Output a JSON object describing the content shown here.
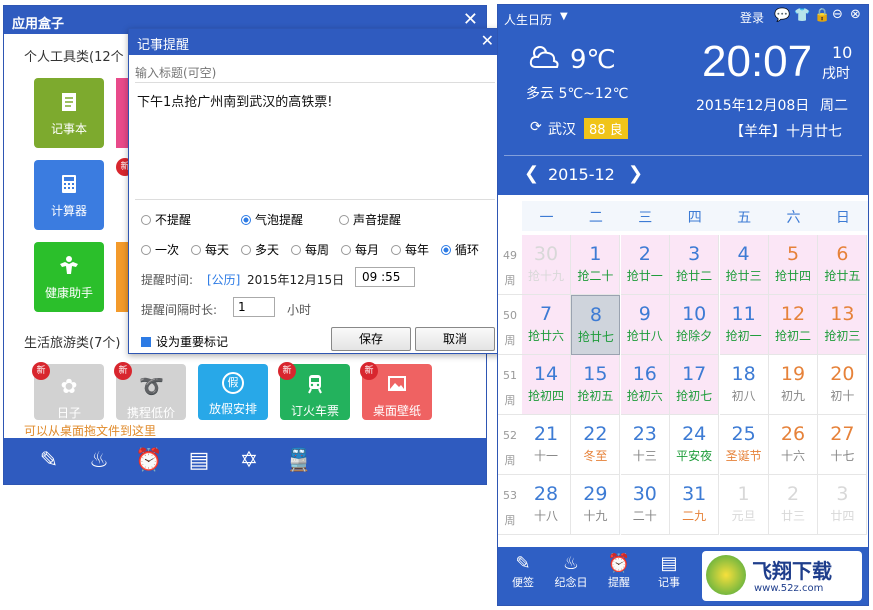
{
  "appbox": {
    "title": "应用盒子",
    "section1": "个人工具类(12个",
    "section2": "生活旅游类(7个)",
    "drag_hint": "可以从桌面拖文件到这里",
    "tiles1": [
      {
        "label": "记事本",
        "color": "#7daa2e",
        "icon": "notepad-icon"
      },
      {
        "label": "计算器",
        "color": "#3b7ce0",
        "icon": "calculator-icon",
        "new": "新"
      },
      {
        "label": "健康助手",
        "color": "#2bbf2b",
        "icon": "fitness-icon"
      }
    ],
    "tiles2": [
      {
        "label": "日子",
        "color": "#cfcfcf",
        "icon": "clover-icon",
        "new": "新"
      },
      {
        "label": "携程低价",
        "color": "#cfcfcf",
        "icon": "dolphin-icon",
        "new": "新"
      },
      {
        "label": "放假安排",
        "color": "#28a8e8",
        "icon": "holiday-icon"
      },
      {
        "label": "订火车票",
        "color": "#23b25d",
        "icon": "train-icon",
        "new": "新"
      },
      {
        "label": "桌面壁纸",
        "color": "#ef6262",
        "icon": "wallpaper-icon",
        "new": "新"
      }
    ]
  },
  "dialog": {
    "title": "记事提醒",
    "title_placeholder": "输入标题(可空)",
    "content": "下午1点抢广州南到武汉的高铁票!",
    "remind_types": [
      "不提醒",
      "气泡提醒",
      "声音提醒"
    ],
    "repeat_types": [
      "一次",
      "每天",
      "多天",
      "每周",
      "每月",
      "每年",
      "循环"
    ],
    "time_label": "提醒时间:",
    "calendar_type": "[公历]",
    "date": "2015年12月15日",
    "time": "09 :55",
    "interval_label": "提醒间隔时长:",
    "interval_value": "1",
    "interval_unit": "小时",
    "important_label": "设为重要标记",
    "save": "保存",
    "cancel": "取消"
  },
  "calendar": {
    "app_title": "人生日历",
    "login": "登录",
    "temp": "9℃",
    "weather": "多云 5℃~12℃",
    "city": "武汉",
    "aqi": "88 良",
    "time": "20:07",
    "seconds": "10",
    "hour_label": "戌时",
    "date": "2015年12月08日",
    "weekday": "周二",
    "lunar": "【羊年】十月廿七",
    "month": "2015-12",
    "weekdays": [
      "一",
      "二",
      "三",
      "四",
      "五",
      "六",
      "日"
    ],
    "weeks": [
      {
        "no": "49",
        "unit": "周",
        "days": [
          {
            "d": "30",
            "l": "抢十九",
            "faded": true
          },
          {
            "d": "1",
            "l": "抢二十"
          },
          {
            "d": "2",
            "l": "抢廿一"
          },
          {
            "d": "3",
            "l": "抢廿二"
          },
          {
            "d": "4",
            "l": "抢廿三"
          },
          {
            "d": "5",
            "l": "抢廿四",
            "weekend": true
          },
          {
            "d": "6",
            "l": "抢廿五",
            "weekend": true
          }
        ]
      },
      {
        "no": "50",
        "unit": "周",
        "days": [
          {
            "d": "7",
            "l": "抢廿六"
          },
          {
            "d": "8",
            "l": "抢廿七",
            "today": true
          },
          {
            "d": "9",
            "l": "抢廿八"
          },
          {
            "d": "10",
            "l": "抢除夕"
          },
          {
            "d": "11",
            "l": "抢初一"
          },
          {
            "d": "12",
            "l": "抢初二",
            "weekend": true
          },
          {
            "d": "13",
            "l": "抢初三",
            "weekend": true
          }
        ]
      },
      {
        "no": "51",
        "unit": "周",
        "days": [
          {
            "d": "14",
            "l": "抢初四"
          },
          {
            "d": "15",
            "l": "抢初五"
          },
          {
            "d": "16",
            "l": "抢初六"
          },
          {
            "d": "17",
            "l": "抢初七"
          },
          {
            "d": "18",
            "l": "初八",
            "plain": true
          },
          {
            "d": "19",
            "l": "初九",
            "plain": true,
            "weekend": true
          },
          {
            "d": "20",
            "l": "初十",
            "plain": true,
            "weekend": true
          }
        ]
      },
      {
        "no": "52",
        "unit": "周",
        "days": [
          {
            "d": "21",
            "l": "十一",
            "plain": true
          },
          {
            "d": "22",
            "l": "冬至",
            "plain": true,
            "fest": true
          },
          {
            "d": "23",
            "l": "十三",
            "plain": true
          },
          {
            "d": "24",
            "l": "平安夜",
            "plain": true,
            "green": true
          },
          {
            "d": "25",
            "l": "圣诞节",
            "plain": true,
            "fest": true
          },
          {
            "d": "26",
            "l": "十六",
            "plain": true,
            "weekend": true
          },
          {
            "d": "27",
            "l": "十七",
            "plain": true,
            "weekend": true
          }
        ]
      },
      {
        "no": "53",
        "unit": "周",
        "days": [
          {
            "d": "28",
            "l": "十八",
            "plain": true
          },
          {
            "d": "29",
            "l": "十九",
            "plain": true
          },
          {
            "d": "30",
            "l": "二十",
            "plain": true
          },
          {
            "d": "31",
            "l": "二九",
            "plain": true,
            "fest": true
          },
          {
            "d": "1",
            "l": "元旦",
            "faded": true
          },
          {
            "d": "2",
            "l": "廿三",
            "faded": true
          },
          {
            "d": "3",
            "l": "廿四",
            "faded": true
          }
        ]
      }
    ],
    "bottom": [
      "便签",
      "纪念日",
      "提醒",
      "记事"
    ],
    "brand": "飞翔下载",
    "brand_url": "www.52z.com"
  }
}
